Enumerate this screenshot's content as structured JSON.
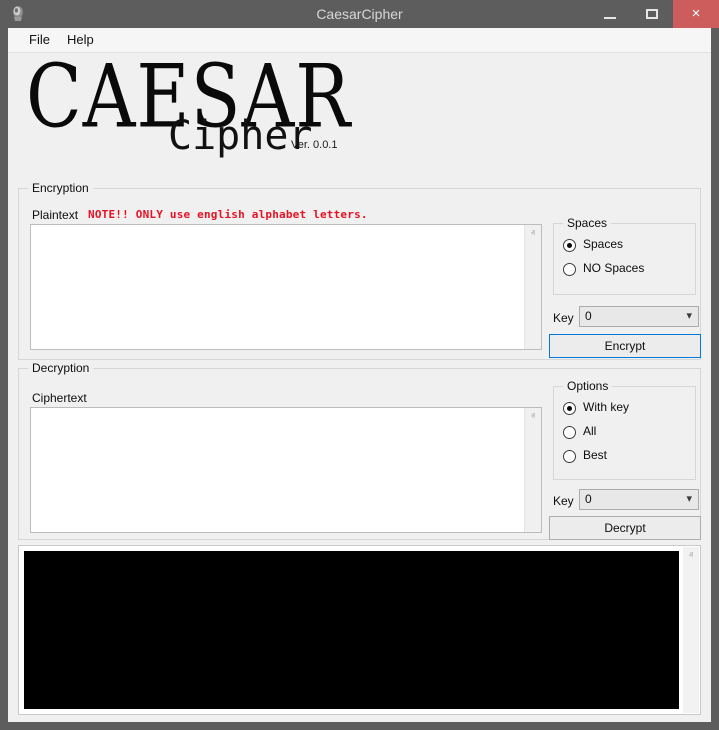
{
  "window": {
    "title": "CaesarCipher",
    "icon": "app-icon",
    "minimize_label": "–",
    "maximize_label": "□",
    "close_label": "×",
    "titlebar_color": "#5d5d5d",
    "close_button_color": "#cd5c5c",
    "client_background": "#f0f0f0"
  },
  "menubar": {
    "items": [
      {
        "label": "File"
      },
      {
        "label": "Help"
      }
    ]
  },
  "logo": {
    "primary": "CAESAR",
    "secondary": "Cipher",
    "version": "Ver. 0.0.1"
  },
  "encryption": {
    "group_title": "Encryption",
    "plaintext_label": "Plaintext",
    "note": "NOTE!! ONLY use english alphabet letters.",
    "note_color": "#e81123",
    "plaintext_value": "",
    "plaintext_placeholder": "",
    "spaces_group": {
      "title": "Spaces",
      "options": [
        {
          "label": "Spaces",
          "selected": true
        },
        {
          "label": "NO Spaces",
          "selected": false
        }
      ]
    },
    "key_label": "Key",
    "key_value": "0",
    "encrypt_button": "Encrypt",
    "encrypt_focus_color": "#0078d7"
  },
  "decryption": {
    "group_title": "Decryption",
    "ciphertext_label": "Ciphertext",
    "ciphertext_value": "",
    "ciphertext_placeholder": "",
    "options_group": {
      "title": "Options",
      "options": [
        {
          "label": "With key",
          "selected": true
        },
        {
          "label": "All",
          "selected": false
        },
        {
          "label": "Best",
          "selected": false
        }
      ]
    },
    "key_label": "Key",
    "key_value": "0",
    "decrypt_button": "Decrypt"
  },
  "console": {
    "text": "",
    "background": "#000000"
  },
  "scrollbars": {
    "up_arrow": "ⱏ",
    "down_arrow": "ⱟ"
  }
}
